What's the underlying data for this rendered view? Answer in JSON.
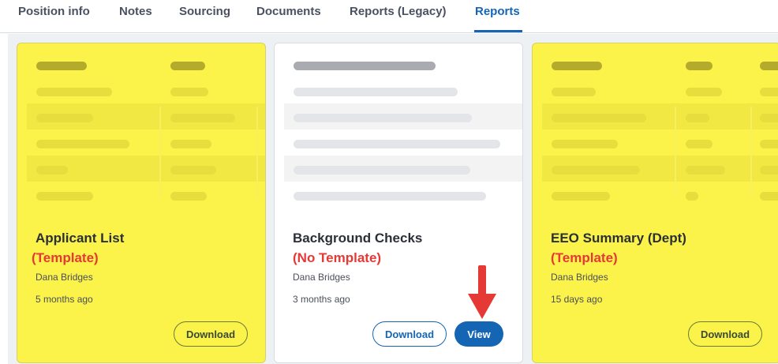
{
  "tabs": [
    {
      "label": "Position info"
    },
    {
      "label": "Notes"
    },
    {
      "label": "Sourcing"
    },
    {
      "label": "Documents"
    },
    {
      "label": "Reports (Legacy)"
    },
    {
      "label": "Reports",
      "active": true
    }
  ],
  "cards": [
    {
      "title": "Applicant List",
      "status": "(Template)",
      "owner": "Dana Bridges",
      "date": "5 months ago",
      "download_label": "Download",
      "highlighted": true
    },
    {
      "title": "Background Checks",
      "status": "(No Template)",
      "owner": "Dana Bridges",
      "date": "3 months ago",
      "download_label": "Download",
      "view_label": "View",
      "highlighted": false
    },
    {
      "title": "EEO Summary (Dept)",
      "status": "(Template)",
      "owner": "Dana Bridges",
      "date": "15 days ago",
      "download_label": "Download",
      "highlighted": true
    }
  ],
  "annotation": {
    "arrow_icon": "red-arrow-down-icon",
    "arrow_color": "#e53935"
  },
  "colors": {
    "accent": "#1565b5",
    "highlight": "#fbf24a",
    "status_red": "#e53935"
  }
}
